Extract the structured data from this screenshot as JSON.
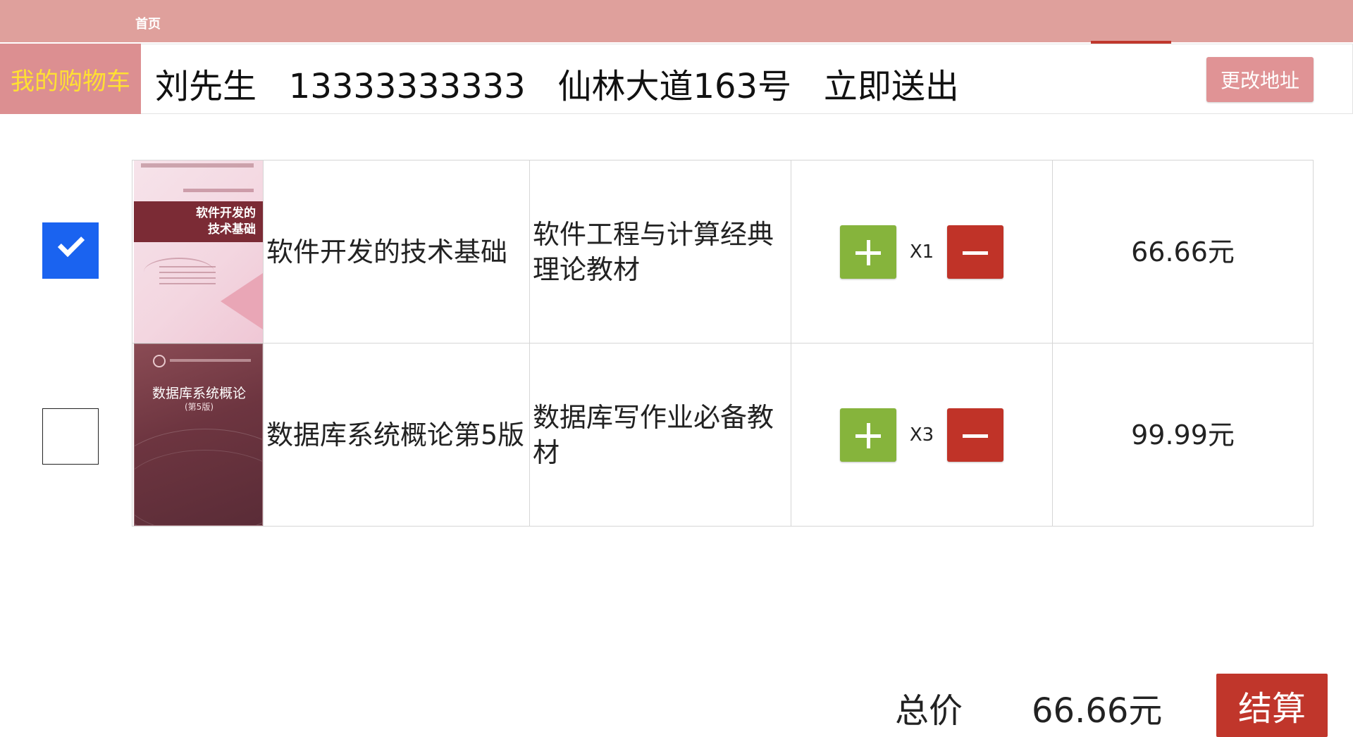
{
  "nav": {
    "home_label": "首页"
  },
  "address_bar": {
    "cart_label": "我的购物车",
    "address_text": "刘先生   13333333333   仙林大道163号   立即送出",
    "change_button_label": "更改地址"
  },
  "cart": {
    "items": [
      {
        "selected": true,
        "name": "软件开发的技术基础",
        "description": "软件工程与计算经典理论教材",
        "quantity_label": "X1",
        "price_label": "66.66元",
        "cover": {
          "title_line1": "软件开发的",
          "title_line2": "技术基础"
        }
      },
      {
        "selected": false,
        "name": "数据库系统概论第5版",
        "description": "数据库写作业必备教材",
        "quantity_label": "X3",
        "price_label": "99.99元",
        "cover": {
          "title": "数据库系统概论",
          "edition": "(第5版)"
        }
      }
    ]
  },
  "footer": {
    "total_label": "总价",
    "total_value": "66.66元",
    "checkout_label": "结算"
  },
  "colors": {
    "topbar": "#dfa09c",
    "cart_tag": "#dc8f91",
    "cart_tag_text": "#ffe033",
    "checkbox_checked": "#1a63f0",
    "plus_button": "#86b43c",
    "minus_button": "#c03328",
    "checkout_button": "#c0362b"
  }
}
